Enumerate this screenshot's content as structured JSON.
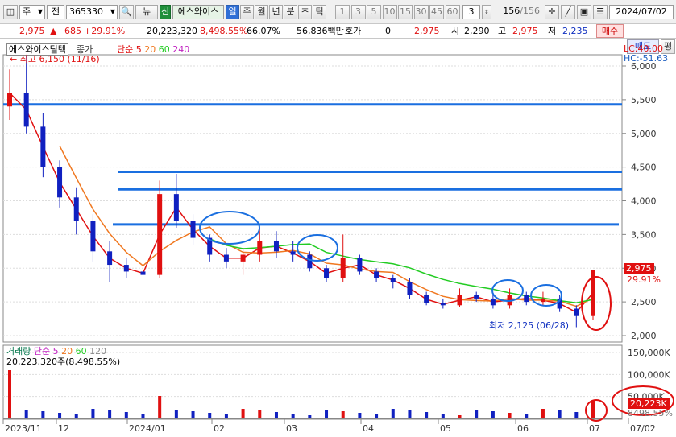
{
  "toolbar": {
    "market": "주",
    "kind": "전",
    "code": "365330",
    "news": "뉴",
    "credit": "신",
    "stock_name": "에스와이스",
    "periods": [
      "일",
      "주",
      "월",
      "년",
      "분",
      "초",
      "틱"
    ],
    "active_period": "일",
    "minutes": [
      "1",
      "3",
      "5",
      "10",
      "15",
      "30",
      "45",
      "60"
    ],
    "count_select": "3",
    "page_current": "156",
    "page_total": "/156",
    "date": "2024/07/02"
  },
  "quote": {
    "price": "2,975",
    "arrow": "▲",
    "change": "685",
    "change_pct": "+29.91%",
    "volume": "20,223,320",
    "volume_ratio": "8,498.55%",
    "turnover": "66.07%",
    "amount": "56,836백만",
    "hoga_label": "호가",
    "hoga_value": "0",
    "ask_price": "2,975",
    "open_label": "시",
    "open": "2,290",
    "high_label": "고",
    "high": "2,975",
    "low_label": "저",
    "low": "2,235",
    "buy_label": "매수",
    "sell_label": "매도",
    "extra_label": "평"
  },
  "price_panel": {
    "legend_name": "에스와이스틸텍",
    "legend_price": "종가",
    "legend_ma": "단순",
    "ma_periods": [
      "5",
      "20",
      "60",
      "240"
    ],
    "lc": "LC:40.00",
    "hc": "HC:-51.63",
    "high_note": "최고 6,150 (11/16)",
    "low_note": "최저 2,125 (06/28)",
    "y_ticks": [
      "6,000",
      "5,500",
      "5,000",
      "4,500",
      "4,000",
      "3,500",
      "3,000",
      "2,500",
      "2,000"
    ],
    "current_price_tag": "2,975",
    "current_pct_tag": "29.91%"
  },
  "volume_panel": {
    "legend_name": "거래량",
    "legend_ma": "단순",
    "ma_periods": [
      "5",
      "20",
      "60",
      "120"
    ],
    "value_line": "20,223,320주(8,498.55%)",
    "y_ticks": [
      "150,000K",
      "100,000K",
      "50,000K"
    ],
    "current_tag": "20,223K",
    "pct_tag": "8498.55%"
  },
  "x_axis": [
    "2023/11",
    "12",
    "2024/01",
    "02",
    "03",
    "04",
    "05",
    "06",
    "07",
    "07/02"
  ],
  "colors": {
    "up": "#e01010",
    "down": "#1020c0",
    "ma5": "#e01010",
    "ma20": "#f07820",
    "ma60": "#22cc22",
    "ma240": "#c020c0",
    "hline": "#1a6fe0",
    "circle_blue": "#1a6fe0",
    "circle_red": "#e01010"
  },
  "chart_data": {
    "type": "candlestick",
    "ylim": [
      2000,
      6000
    ],
    "hlines": [
      5430,
      4430,
      4170,
      3650
    ],
    "ohlc_weekly_approx": [
      [
        5400,
        5950,
        5200,
        5600
      ],
      [
        5600,
        6150,
        5000,
        5100
      ],
      [
        5100,
        5300,
        4350,
        4500
      ],
      [
        4500,
        4600,
        3900,
        4050
      ],
      [
        4050,
        4200,
        3500,
        3700
      ],
      [
        3700,
        3800,
        3100,
        3250
      ],
      [
        3250,
        3400,
        2800,
        3050
      ],
      [
        3050,
        3150,
        2850,
        2950
      ],
      [
        2950,
        3050,
        2780,
        2900
      ],
      [
        2900,
        4300,
        2850,
        4100
      ],
      [
        4100,
        4400,
        3600,
        3700
      ],
      [
        3700,
        3800,
        3350,
        3450
      ],
      [
        3450,
        3500,
        3100,
        3200
      ],
      [
        3200,
        3300,
        3000,
        3100
      ],
      [
        3100,
        3300,
        2900,
        3200
      ],
      [
        3200,
        3600,
        3100,
        3400
      ],
      [
        3400,
        3550,
        3150,
        3250
      ],
      [
        3250,
        3400,
        3100,
        3200
      ],
      [
        3200,
        3250,
        2950,
        3000
      ],
      [
        3000,
        3050,
        2800,
        2850
      ],
      [
        2850,
        3500,
        2800,
        3150
      ],
      [
        3150,
        3200,
        2900,
        2950
      ],
      [
        2950,
        3000,
        2800,
        2850
      ],
      [
        2850,
        2900,
        2700,
        2800
      ],
      [
        2800,
        2850,
        2550,
        2600
      ],
      [
        2600,
        2650,
        2450,
        2480
      ],
      [
        2480,
        2550,
        2400,
        2450
      ],
      [
        2450,
        2700,
        2430,
        2600
      ],
      [
        2600,
        2650,
        2500,
        2550
      ],
      [
        2550,
        2600,
        2400,
        2450
      ],
      [
        2450,
        2700,
        2400,
        2600
      ],
      [
        2600,
        2650,
        2450,
        2500
      ],
      [
        2500,
        2650,
        2450,
        2550
      ],
      [
        2550,
        2600,
        2350,
        2400
      ],
      [
        2400,
        2450,
        2125,
        2290
      ],
      [
        2290,
        2975,
        2235,
        2975
      ]
    ]
  }
}
